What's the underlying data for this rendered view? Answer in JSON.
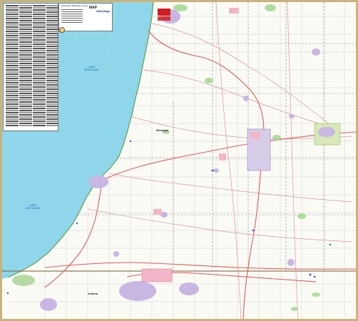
{
  "map": {
    "lake_label": [
      "LAKE",
      "MICHIGAN"
    ],
    "state_labels": {
      "michigan": "Michigan",
      "indiana": "Indiana"
    },
    "colors": {
      "water": "#8fd6ea",
      "land": "#fbfbf6",
      "frame": "#c9b27c",
      "city": "#f3b6c9",
      "urban_purple": "#c8b6e3",
      "roads": "#d99595",
      "highways": "#e05a5a",
      "green": "#9fd58a"
    }
  },
  "legend": {
    "title": "Southwest Michigan County",
    "brand": "MAP",
    "brand_sub": "Wall Maps"
  },
  "icons": {
    "compass": "compass-rose-icon"
  }
}
